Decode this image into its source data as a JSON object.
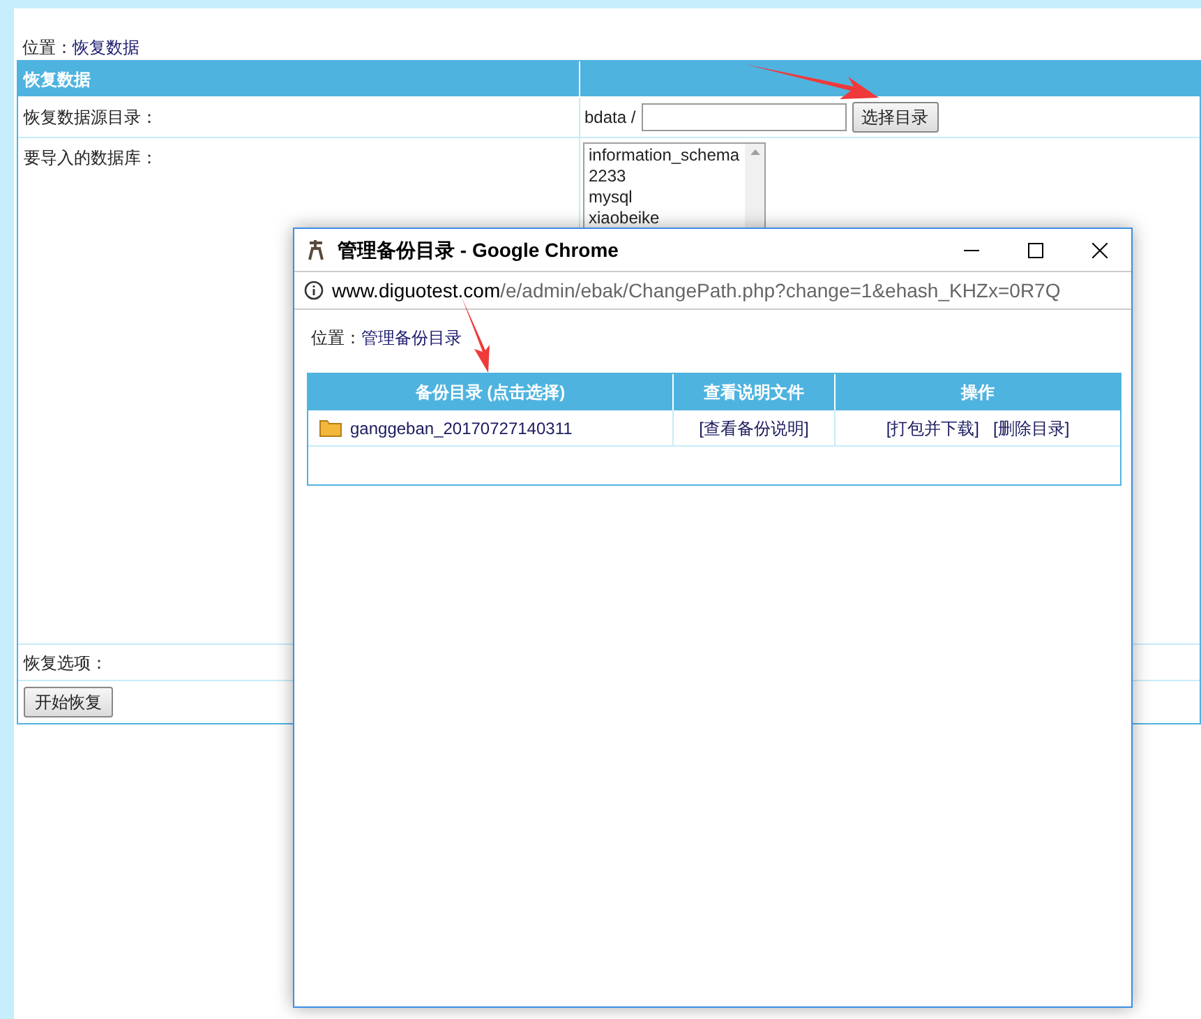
{
  "location": {
    "label": "位置：",
    "link": "恢复数据"
  },
  "main_table": {
    "header": "恢复数据",
    "source_dir": {
      "label": "恢复数据源目录：",
      "prefix": "bdata /",
      "button": "选择目录"
    },
    "databases": {
      "label": "要导入的数据库：",
      "options": [
        {
          "text": "information_schema",
          "selected": false
        },
        {
          "text": "2233",
          "selected": false
        },
        {
          "text": "mysql",
          "selected": false
        },
        {
          "text": "xiaobeike",
          "selected": false
        }
      ]
    },
    "restore_options": {
      "label": "恢复选项："
    },
    "start_button": "开始恢复"
  },
  "popup": {
    "title": "管理备份目录 - Google Chrome",
    "url_host": "www.diguotest.com",
    "url_path": "/e/admin/ebak/ChangePath.php?change=1&ehash_KHZx=0R7Q",
    "location": {
      "label": "位置：",
      "link": "管理备份目录"
    },
    "columns": [
      "备份目录 (点击选择)",
      "查看说明文件",
      "操作"
    ],
    "rows": [
      {
        "dir": "ganggeban_20170727140311",
        "readme": "[查看备份说明]",
        "actions": [
          "[打包并下载]",
          "[删除目录]"
        ]
      }
    ]
  }
}
